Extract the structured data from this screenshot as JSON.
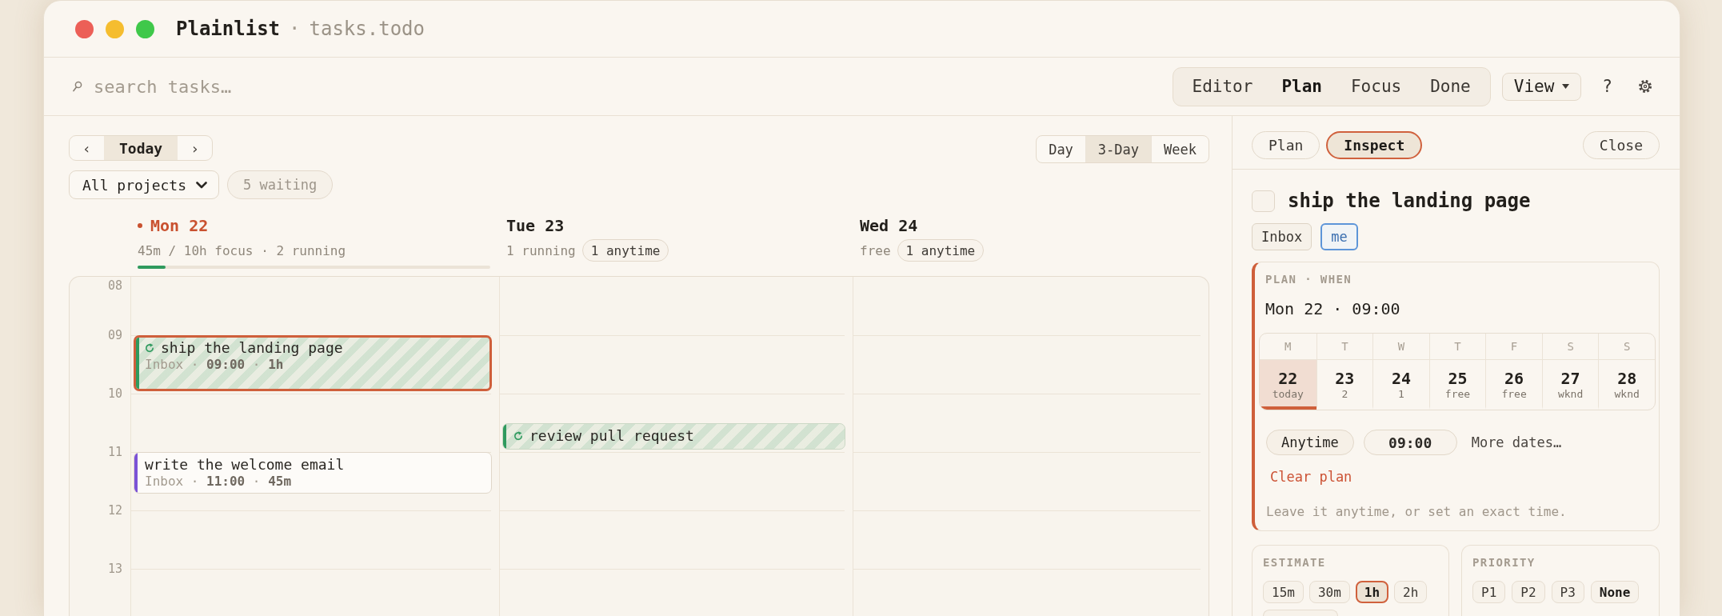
{
  "window": {
    "title": "Plainlist",
    "separator": "·",
    "subtitle": "tasks.todo"
  },
  "toolbar": {
    "search": {
      "placeholder": "search tasks…"
    },
    "modes": [
      {
        "label": "Editor",
        "selected": false
      },
      {
        "label": "Plan",
        "selected": true
      },
      {
        "label": "Focus",
        "selected": false
      },
      {
        "label": "Done",
        "selected": false
      }
    ],
    "view_menu": {
      "label": "View"
    },
    "help": "?"
  },
  "calendar": {
    "nav": {
      "previous": "‹",
      "current": "Today",
      "next": "›"
    },
    "project_filter": "All projects",
    "waiting": "5 waiting",
    "ranges": [
      {
        "label": "Day",
        "selected": false
      },
      {
        "label": "3-Day",
        "selected": true
      },
      {
        "label": "Week",
        "selected": false
      }
    ],
    "hours": [
      "08",
      "09",
      "10",
      "11",
      "12",
      "13"
    ],
    "days": [
      {
        "label": "Mon 22",
        "today": true,
        "summary": "45m / 10h focus · 2 running",
        "level": 0.08,
        "events": [
          {
            "title": "ship the landing page",
            "meta": "Inbox · **09:00** · **1h**",
            "color": "#2f9a5e",
            "running": true,
            "selected": true
          },
          {
            "title": "write the welcome email",
            "meta": "Inbox · **11:00** · **45m**",
            "color": "#7b52d6",
            "running": false,
            "selected": false
          }
        ]
      },
      {
        "label": "Tue 23",
        "today": false,
        "summary": "1 running",
        "badge": "1 anytime",
        "events": [
          {
            "title": "review pull request",
            "color": "#2f9a5e",
            "running": true,
            "selected": false
          }
        ]
      },
      {
        "label": "Wed 24",
        "today": false,
        "summary": "free",
        "badge": "1 anytime"
      }
    ]
  },
  "inspector": {
    "tabs": [
      {
        "label": "Plan",
        "selected": false
      },
      {
        "label": "Inspect",
        "selected": true
      }
    ],
    "close": "Close",
    "task": {
      "title": "ship the landing page",
      "done": false,
      "tags": [
        {
          "label": "Inbox",
          "kind": "project"
        },
        {
          "label": "me",
          "kind": "assignee"
        }
      ]
    },
    "plan": {
      "heading": "PLAN · WHEN",
      "value": "Mon 22 · 09:00",
      "week": [
        {
          "weekday": "M",
          "date": "22",
          "note": "today",
          "selected": true
        },
        {
          "weekday": "T",
          "date": "23",
          "note": "2",
          "selected": false
        },
        {
          "weekday": "W",
          "date": "24",
          "note": "1",
          "selected": false
        },
        {
          "weekday": "T",
          "date": "25",
          "note": "free",
          "selected": false
        },
        {
          "weekday": "F",
          "date": "26",
          "note": "free",
          "selected": false
        },
        {
          "weekday": "S",
          "date": "27",
          "note": "wknd",
          "selected": false
        },
        {
          "weekday": "S",
          "date": "28",
          "note": "wknd",
          "selected": false
        }
      ],
      "anytime": "Anytime",
      "time": {
        "value": "09:00"
      },
      "more_dates": "More dates…",
      "clear": "Clear plan",
      "hint": "Leave it anytime, or set an exact time."
    },
    "estimate": {
      "heading": "ESTIMATE",
      "options": [
        {
          "label": "15m",
          "selected": false
        },
        {
          "label": "30m",
          "selected": false
        },
        {
          "label": "1h",
          "selected": true
        },
        {
          "label": "2h",
          "selected": false
        }
      ],
      "more_options_cut_off": true
    },
    "priority": {
      "heading": "PRIORITY",
      "options": [
        {
          "label": "P1",
          "selected": false
        },
        {
          "label": "P2",
          "selected": false
        },
        {
          "label": "P3",
          "selected": false
        },
        {
          "label": "None",
          "selected": true
        }
      ]
    }
  }
}
